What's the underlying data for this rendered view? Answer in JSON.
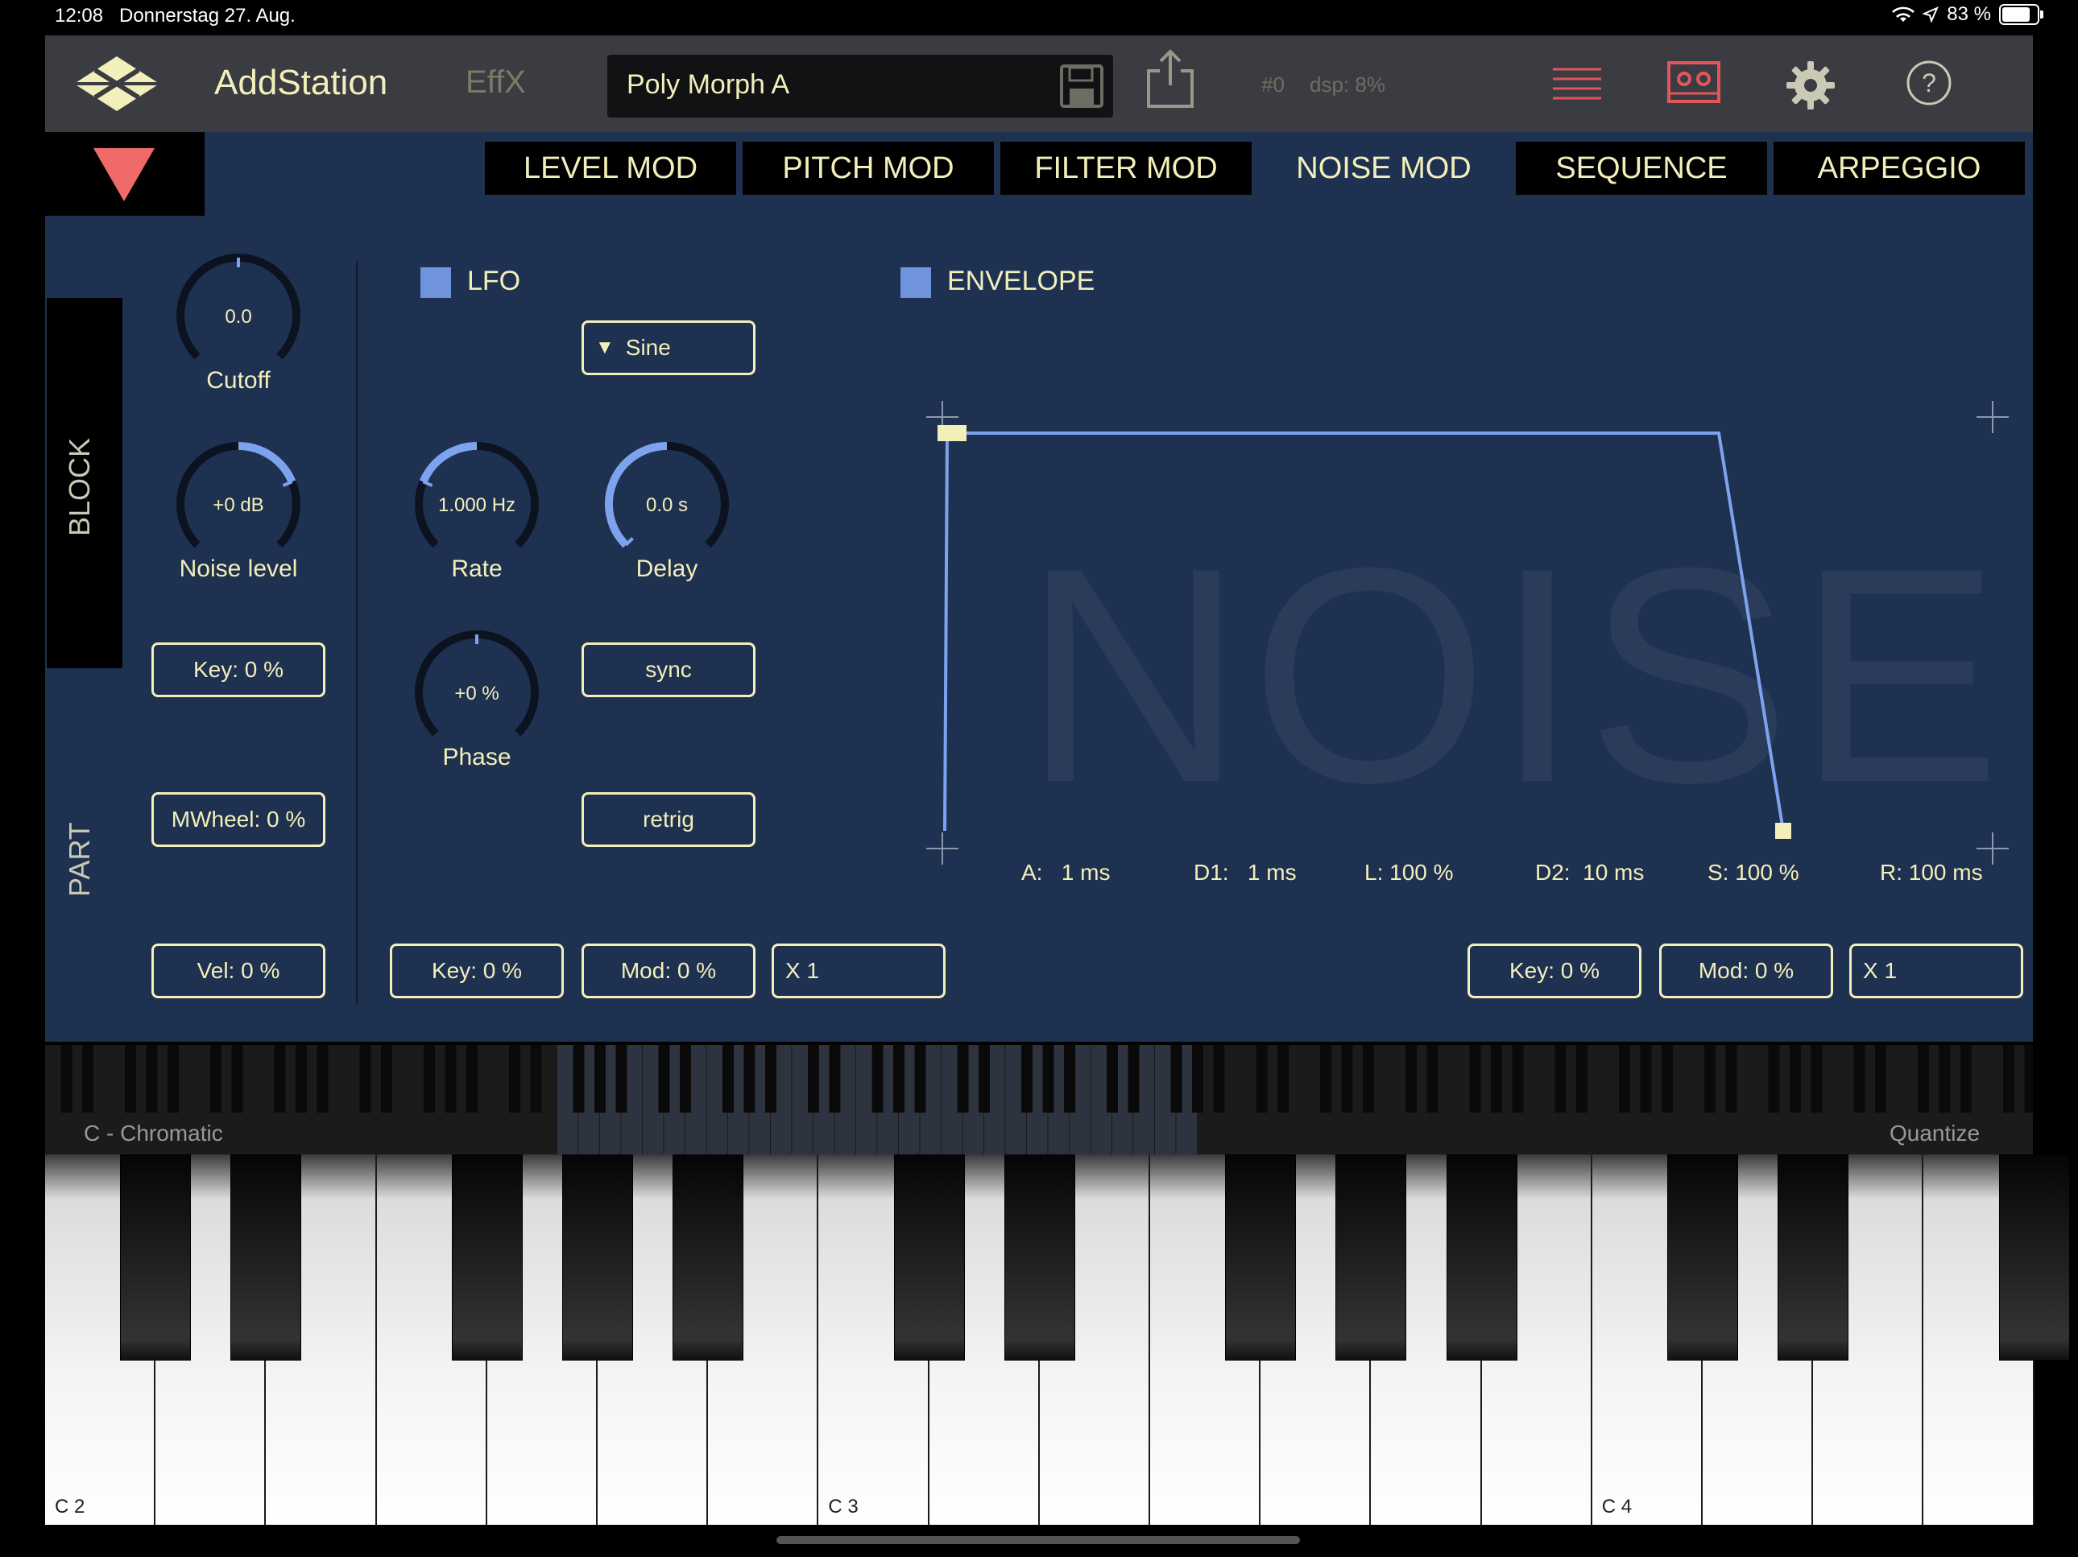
{
  "status_bar": {
    "time": "12:08",
    "date": "Donnerstag 27. Aug.",
    "battery": "83 %",
    "battery_level": 0.83
  },
  "header": {
    "app_name": "AddStation",
    "effx_label": "EffX",
    "preset_name": "Poly Morph A",
    "preset_index": "#0",
    "dsp": "dsp: 8%",
    "icons": [
      "logo-icon",
      "save-icon",
      "share-icon",
      "list-icon",
      "tape-icon",
      "gear-icon",
      "help-icon"
    ]
  },
  "tabs": [
    {
      "label": "LEVEL MOD",
      "active": false
    },
    {
      "label": "PITCH MOD",
      "active": false
    },
    {
      "label": "FILTER MOD",
      "active": false
    },
    {
      "label": "NOISE MOD",
      "active": true
    },
    {
      "label": "SEQUENCE",
      "active": false
    },
    {
      "label": "ARPEGGIO",
      "active": false
    }
  ],
  "side": {
    "block_label": "BLOCK",
    "part_label": "PART"
  },
  "left_column": {
    "cutoff": {
      "value": "0.0",
      "label": "Cutoff",
      "level": 0.5
    },
    "noise_level": {
      "value": "+0 dB",
      "label": "Noise level",
      "level": 0.75
    },
    "key": "Key:  0 %",
    "mwheel": "MWheel:  0 %",
    "vel": "Vel:  0 %"
  },
  "lfo": {
    "label": "LFO",
    "enabled": true,
    "waveform": "Sine",
    "rate": {
      "value": "1.000 Hz",
      "label": "Rate",
      "level": 0.25
    },
    "delay": {
      "value": "0.0 s",
      "label": "Delay",
      "level": 0.0
    },
    "phase": {
      "value": "+0 %",
      "label": "Phase",
      "level": 0.5
    },
    "sync": "sync",
    "retrig": "retrig",
    "key": "Key:  0 %",
    "mod": "Mod:  0 %",
    "mult": "X   1"
  },
  "envelope": {
    "label": "ENVELOPE",
    "enabled": true,
    "watermark": "NOISE",
    "params": {
      "a": "A:   1 ms",
      "d1": "D1:   1 ms",
      "l": "L: 100 %",
      "d2": "D2:  10 ms",
      "s": "S: 100 %",
      "r": "R: 100 ms"
    },
    "key": "Key:  0 %",
    "mod": "Mod:  0 %",
    "mult": "X   1"
  },
  "keyboard": {
    "scale": "C - Chromatic",
    "quantize": "Quantize",
    "octave_labels": [
      "C 2",
      "C 3",
      "C 4"
    ]
  },
  "colors": {
    "panel": "#1f3150",
    "text": "#f3efbb",
    "accent_blue": "#7ea3ee",
    "red_triangle": "#f06a6a",
    "header": "#3a3c41"
  }
}
